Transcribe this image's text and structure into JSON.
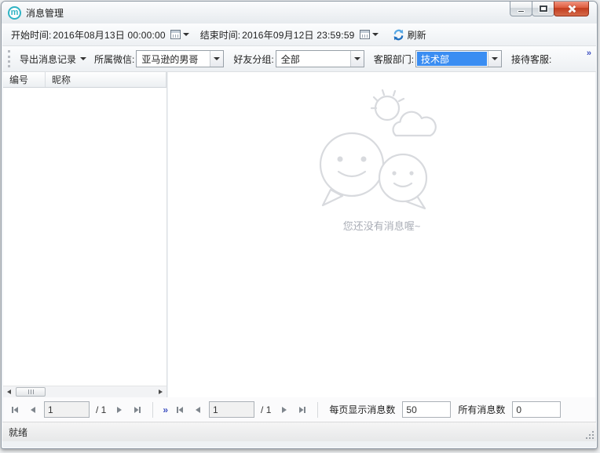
{
  "window": {
    "title": "消息管理",
    "logo_letter": "m"
  },
  "toolbar_datetime": {
    "start_label": "开始时间:",
    "start_value": "2016年08月13日  00:00:00",
    "end_label": "结束时间:",
    "end_value": "2016年09月12日  23:59:59",
    "refresh_label": "刷新"
  },
  "toolbar_filters": {
    "export_label": "导出消息记录",
    "wechat_label": "所属微信:",
    "wechat_value": "亚马逊的男哥",
    "group_label": "好友分组:",
    "group_value": "全部",
    "dept_label": "客服部门:",
    "dept_value": "技术部",
    "agent_label": "接待客服:",
    "overflow_glyph": "»",
    "dept_highlight_color": "#3a8df2"
  },
  "list_panel": {
    "columns": [
      "编号",
      "昵称"
    ],
    "rows": []
  },
  "main": {
    "empty_message": "您还没有消息喔~"
  },
  "pager_left": {
    "page_value": "1",
    "page_total": "/ 1",
    "more_glyph": "»"
  },
  "pager_main": {
    "page_value": "1",
    "page_total": "/ 1"
  },
  "footer": {
    "per_page_label": "每页显示消息数",
    "per_page_value": "50",
    "total_label": "所有消息数",
    "total_value": "0"
  },
  "statusbar": {
    "text": "就绪"
  }
}
